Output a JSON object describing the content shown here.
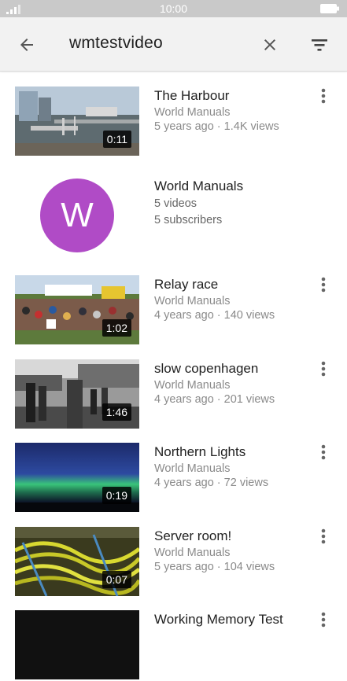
{
  "status_bar": {
    "time": "10:00"
  },
  "search": {
    "query": "wmtestvideo"
  },
  "results": [
    {
      "title": "The Harbour",
      "channel": "World Manuals",
      "meta": "5 years ago · 1.4K views",
      "duration": "0:11"
    },
    {
      "channel_name": "World Manuals",
      "videos": "5 videos",
      "subscribers": "5 subscribers",
      "avatar_letter": "W",
      "avatar_color": "#b04bc6"
    },
    {
      "title": "Relay race",
      "channel": "World Manuals",
      "meta": "4 years ago · 140 views",
      "duration": "1:02"
    },
    {
      "title": "slow copenhagen",
      "channel": "World Manuals",
      "meta": "4 years ago · 201 views",
      "duration": "1:46"
    },
    {
      "title": "Northern Lights",
      "channel": "World Manuals",
      "meta": "4 years ago · 72 views",
      "duration": "0:19"
    },
    {
      "title": "Server room!",
      "channel": "World Manuals",
      "meta": "5 years ago · 104 views",
      "duration": "0:07"
    },
    {
      "title": "Working Memory Test"
    }
  ]
}
